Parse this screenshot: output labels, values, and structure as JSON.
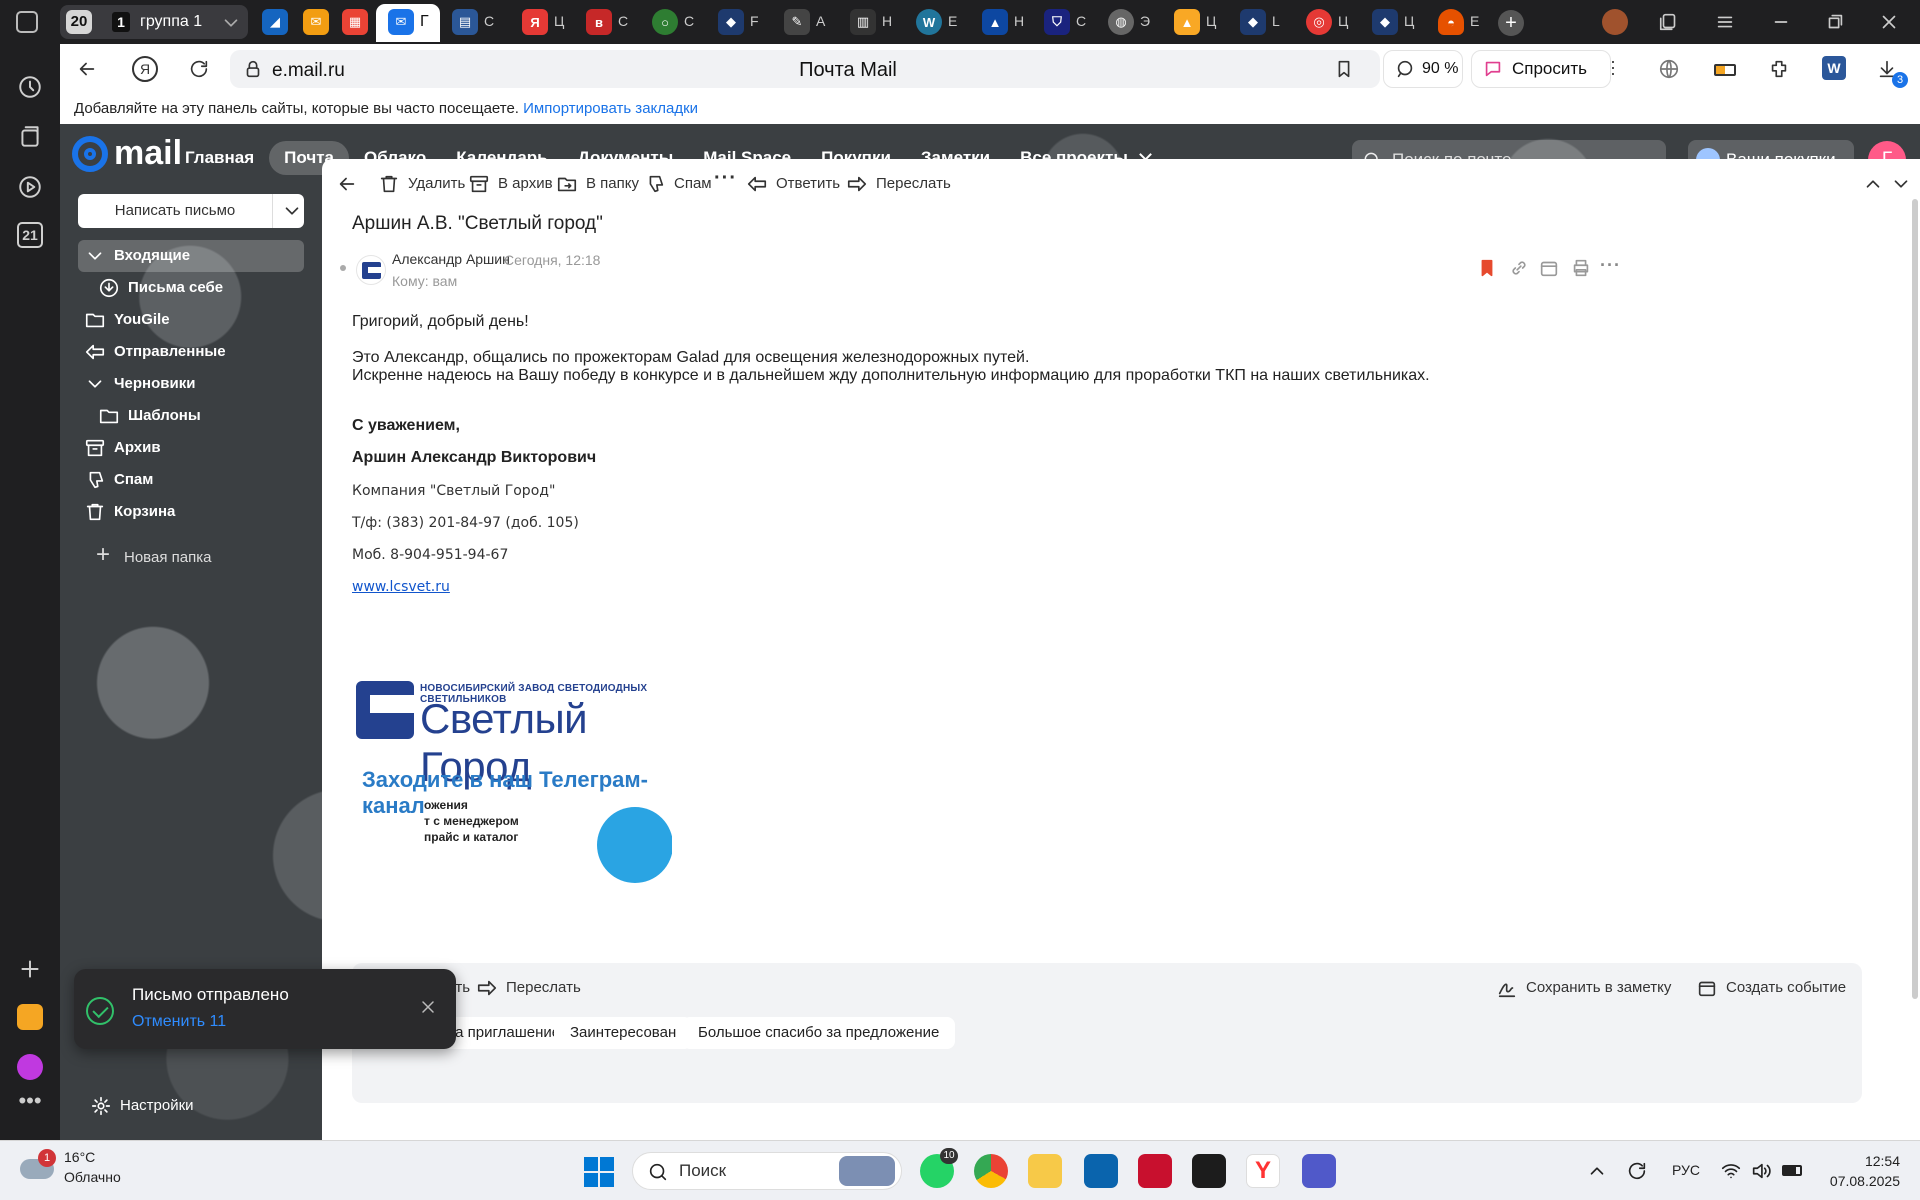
{
  "browser": {
    "group_count": "20",
    "group_number": "1",
    "group_label": "группа 1",
    "active_tab_short": "Г",
    "tab_shorts": [
      "С",
      "Ц",
      "С",
      "С",
      "F",
      "А",
      "Н",
      "E",
      "Н",
      "С",
      "Э",
      "Ц",
      "L",
      "Ц",
      "Ц",
      "E"
    ],
    "url": "e.mail.ru",
    "title": "Почта Mail",
    "zoom": "90 %",
    "ask": "Спросить",
    "downloads_badge": "3",
    "bookmarks_hint": "Добавляйте на эту панель сайты, которые вы часто посещаете.",
    "bookmarks_import": "Импортировать закладки",
    "rail_calendar": "21"
  },
  "mail": {
    "logo": "mail",
    "nav": [
      "Главная",
      "Почта",
      "Облако",
      "Календарь",
      "Документы",
      "Mail Space",
      "Покупки",
      "Заметки",
      "Все проекты"
    ],
    "search_placeholder": "Поиск по почте",
    "purchases": "Ваши покупки",
    "avatar_letter": "Г",
    "compose": "Написать письмо",
    "folders": {
      "inbox": "Входящие",
      "to_self": "Письма себе",
      "yougile": "YouGile",
      "sent": "Отправленные",
      "drafts": "Черновики",
      "templates": "Шаблоны",
      "archive": "Архив",
      "spam": "Спам",
      "trash": "Корзина"
    },
    "new_folder": "Новая папка",
    "settings": "Настройки",
    "toolbar": {
      "delete": "Удалить",
      "archive": "В архив",
      "move": "В папку",
      "spam": "Спам",
      "reply": "Ответить",
      "forward": "Переслать"
    },
    "message": {
      "subject": "Аршин А.В. \"Светлый город\"",
      "from": "Александр Аршин",
      "time": "Сегодня, 12:18",
      "to": "Кому: вам",
      "greeting": "Григорий, добрый день!",
      "line1": "Это Александр, общались по прожекторам Galad для освещения железнодорожных путей.",
      "line2": "Искренне надеюсь на Вашу победу в конкурсе и в дальнейшем жду дополнительную информацию для проработки ТКП на наших светильниках.",
      "regards": "С уважением,",
      "signature_name": "Аршин Александр Викторович",
      "company": "Компания \"Светлый Город\"",
      "phone": "Т/ф: (383) 201-84-97 (доб. 105)",
      "mobile": "Моб. 8-904-951-94-67",
      "website": "www.lcsvet.ru",
      "banner_small": "НОВОСИБИРСКИЙ ЗАВОД СВЕТОДИОДНЫХ СВЕТИЛЬНИКОВ",
      "banner_big": "Светлый Город",
      "banner_tg": "Заходите в наш Телеграм-канал",
      "banner_tg_lines": "ожения\nт с менеджером\nпрайс и каталог"
    },
    "quick_reply": {
      "reply": "Ответить",
      "forward": "Переслать",
      "save_note": "Сохранить в заметку",
      "create_event": "Создать событие",
      "chips": [
        "Спасибо за приглашение",
        "Заинтересован",
        "Большое спасибо за предложение"
      ]
    },
    "toast": {
      "title": "Письмо отправлено",
      "undo": "Отменить 11"
    }
  },
  "taskbar": {
    "weather_badge": "1",
    "temp": "16°C",
    "weather": "Облачно",
    "search": "Поиск",
    "whatsapp_badge": "10",
    "lang": "РУС",
    "time": "12:54",
    "date": "07.08.2025"
  }
}
